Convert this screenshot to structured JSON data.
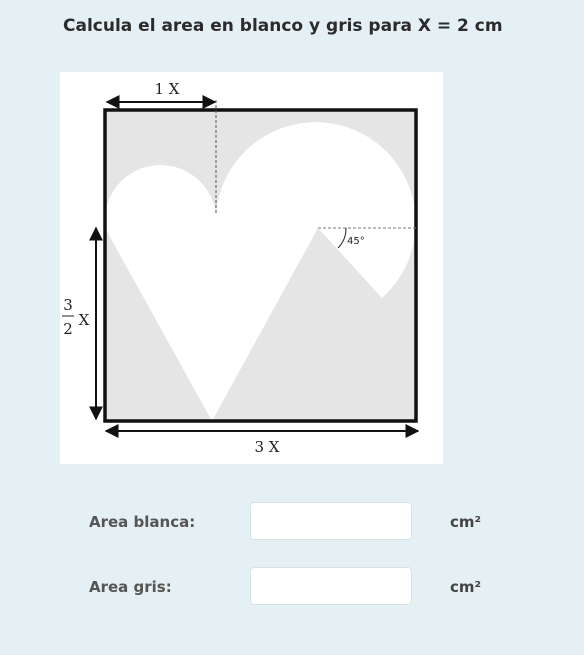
{
  "question": {
    "text": "Calcula el area en blanco y gris para X = 2 cm"
  },
  "figure": {
    "top_dimension": "1 X",
    "left_dimension_numerator": "3",
    "left_dimension_denominator": "2",
    "left_dimension_variable": "X",
    "bottom_dimension": "3 X",
    "angle_label": "45°",
    "colors": {
      "gray_area": "#e5e5e5",
      "white_area": "#ffffff",
      "border": "#111111"
    }
  },
  "answers": [
    {
      "label": "Area blanca:",
      "value": "",
      "unit": "cm²"
    },
    {
      "label": "Area gris:",
      "value": "",
      "unit": "cm²"
    }
  ]
}
